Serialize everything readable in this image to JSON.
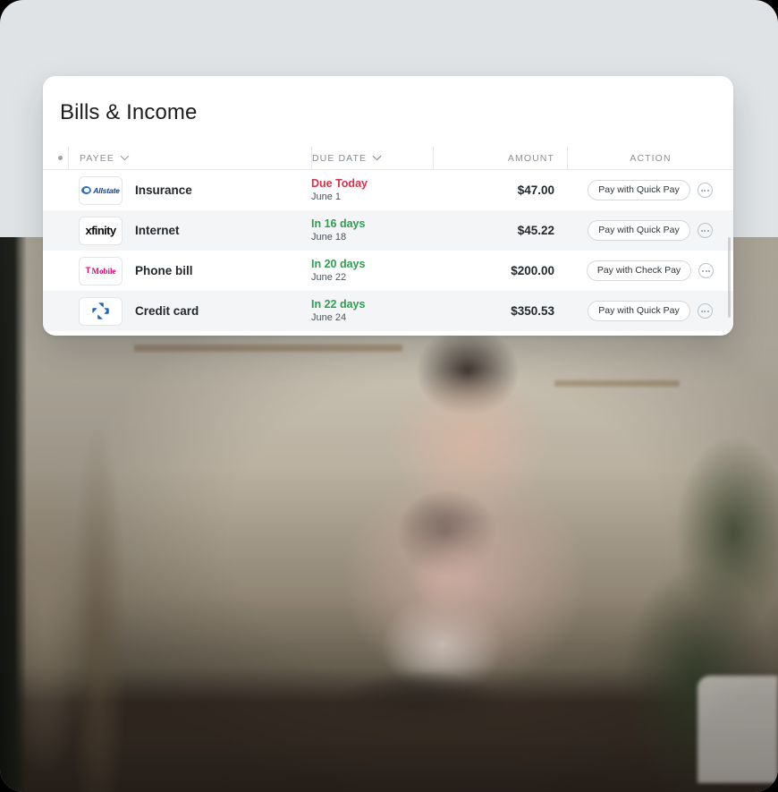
{
  "card": {
    "title": "Bills & Income"
  },
  "table": {
    "header": {
      "dot_icon": "status-dot-icon",
      "payee": "PAYEE",
      "payee_sort_icon": "chevron-down-icon",
      "due_date": "DUE DATE",
      "due_date_sort_icon": "chevron-down-icon",
      "amount": "AMOUNT",
      "action": "ACTION"
    },
    "rows": [
      {
        "logo": "allstate-logo",
        "logo_text": "Allstate",
        "payee": "Insurance",
        "due_label": "Due Today",
        "due_status": "red",
        "due_date": "June 1",
        "amount": "$47.00",
        "action_label": "Pay with Quick Pay",
        "more_icon": "more-options-icon",
        "striped": false
      },
      {
        "logo": "xfinity-logo",
        "logo_text": "xfinity",
        "payee": "Internet",
        "due_label": "In 16 days",
        "due_status": "green",
        "due_date": "June 18",
        "amount": "$45.22",
        "action_label": "Pay with Quick Pay",
        "more_icon": "more-options-icon",
        "striped": true
      },
      {
        "logo": "tmobile-logo",
        "logo_text": "T Mobile",
        "payee": "Phone bill",
        "due_label": "In 20 days",
        "due_status": "green",
        "due_date": "June 22",
        "amount": "$200.00",
        "action_label": "Pay with Check Pay",
        "more_icon": "more-options-icon",
        "striped": false
      },
      {
        "logo": "chase-logo",
        "logo_text": "Chase",
        "payee": "Credit card",
        "due_label": "In 22 days",
        "due_status": "green",
        "due_date": "June 24",
        "amount": "$350.53",
        "action_label": "Pay with Quick Pay",
        "more_icon": "more-options-icon",
        "striped": true
      }
    ]
  },
  "photo": {
    "alt": "Man with glasses holding a baby at a kitchen table using a tablet"
  },
  "colors": {
    "due_overdue": "#d8314a",
    "due_upcoming": "#2e9e4f",
    "page_background": "#dfe3e6",
    "card_background": "#ffffff",
    "row_stripe": "#f4f5f6",
    "header_text": "#8a9199"
  }
}
